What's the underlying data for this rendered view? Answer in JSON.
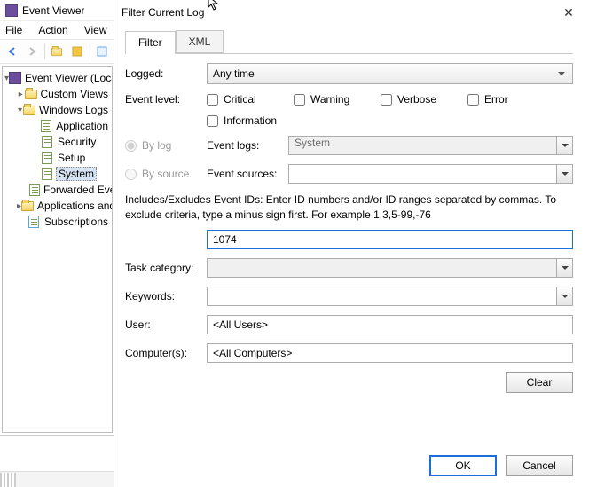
{
  "main": {
    "title": "Event Viewer",
    "menu": {
      "file": "File",
      "action": "Action",
      "view": "View"
    }
  },
  "tree": {
    "root": "Event Viewer (Local)",
    "custom": "Custom Views",
    "winlogs": "Windows Logs",
    "items": {
      "application": "Application",
      "security": "Security",
      "setup": "Setup",
      "system": "System",
      "forwarded": "Forwarded Events"
    },
    "appsvc": "Applications and Services Logs",
    "subs": "Subscriptions"
  },
  "dlg": {
    "title": "Filter Current Log",
    "tabs": {
      "filter": "Filter",
      "xml": "XML"
    },
    "labels": {
      "logged": "Logged:",
      "event_level": "Event level:",
      "by_log": "By log",
      "by_source": "By source",
      "event_logs": "Event logs:",
      "event_sources": "Event sources:",
      "task_category": "Task category:",
      "keywords": "Keywords:",
      "user": "User:",
      "computers": "Computer(s):"
    },
    "logged_value": "Any time",
    "levels": {
      "critical": "Critical",
      "warning": "Warning",
      "verbose": "Verbose",
      "error": "Error",
      "information": "Information"
    },
    "event_logs_value": "System",
    "event_sources_value": "",
    "help": "Includes/Excludes Event IDs: Enter ID numbers and/or ID ranges separated by commas. To exclude criteria, type a minus sign first. For example 1,3,5-99,-76",
    "event_id_value": "1074",
    "user_value": "<All Users>",
    "computers_value": "<All Computers>",
    "buttons": {
      "clear": "Clear",
      "ok": "OK",
      "cancel": "Cancel"
    }
  }
}
